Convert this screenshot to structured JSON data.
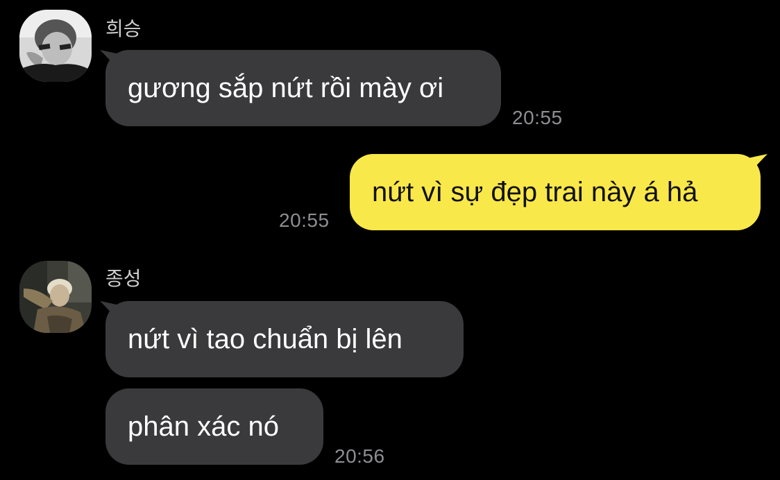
{
  "colors": {
    "background": "#000000",
    "incoming_bubble": "#3a3a3c",
    "outgoing_bubble": "#f9e84a",
    "timestamp": "#8e8e93",
    "sender_name": "#cfcfcf"
  },
  "messages": [
    {
      "sender": "희승",
      "avatar_icon": "profile-photo",
      "bubbles": [
        {
          "text": "gương sắp nứt rồi mày ơi",
          "time": "20:55"
        }
      ]
    },
    {
      "sender": "me",
      "bubbles": [
        {
          "text": "nứt vì sự đẹp trai này á hả",
          "time": "20:55"
        }
      ]
    },
    {
      "sender": "종성",
      "avatar_icon": "profile-photo",
      "bubbles": [
        {
          "text": "nứt vì tao chuẩn bị lên"
        },
        {
          "text": "phân xác nó",
          "time": "20:56"
        }
      ]
    }
  ]
}
